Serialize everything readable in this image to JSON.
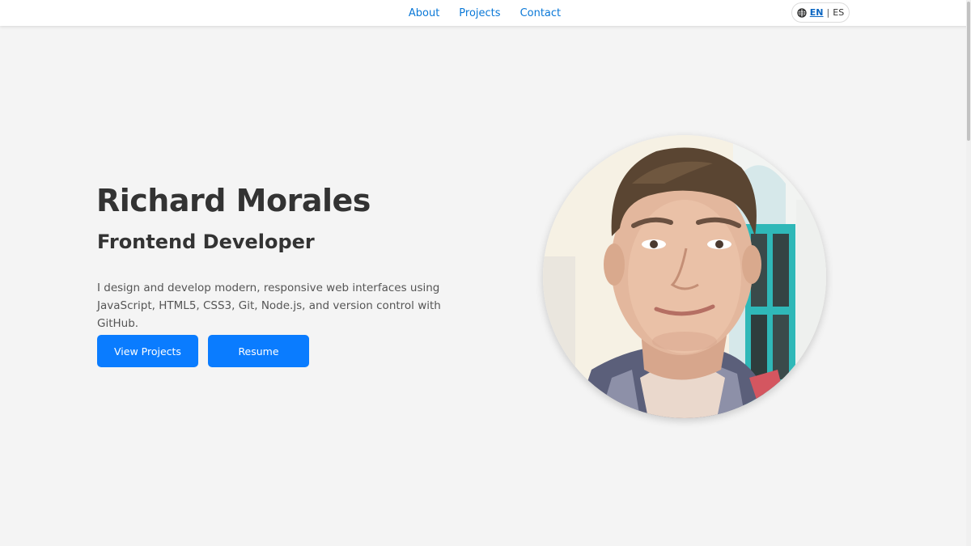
{
  "nav": {
    "links": [
      "About",
      "Projects",
      "Contact"
    ],
    "lang": {
      "active": "EN",
      "separator": "|",
      "other": "ES",
      "icon": "globe-icon"
    }
  },
  "hero": {
    "name": "Richard Morales",
    "role": "Frontend Developer",
    "description": "I design and develop modern, responsive web interfaces using JavaScript, HTML5, CSS3, Git, Node.js, and version control with GitHub.",
    "buttons": {
      "projects": "View Projects",
      "resume": "Resume"
    }
  },
  "colors": {
    "accent": "#0a7cff",
    "link": "#0a78d7",
    "background": "#f4f4f4",
    "text": "#333333"
  }
}
